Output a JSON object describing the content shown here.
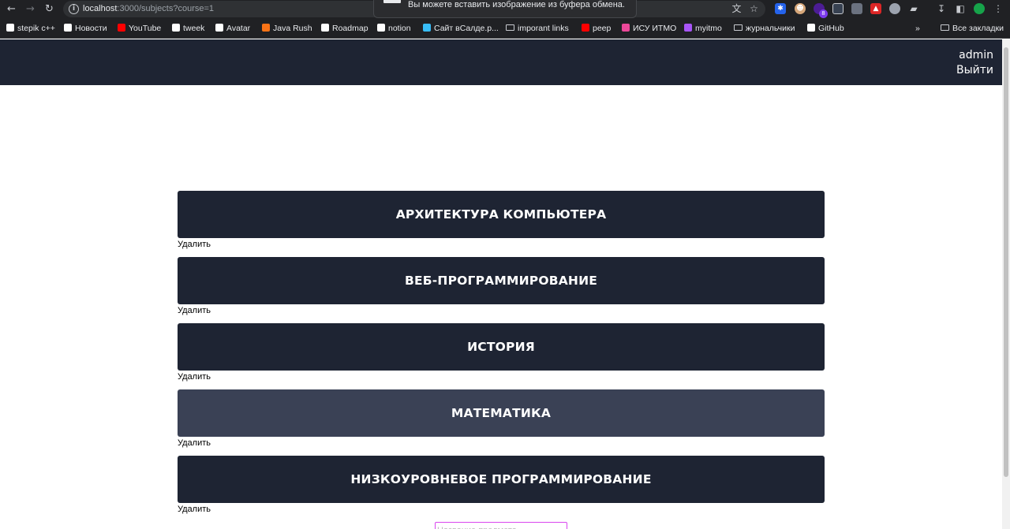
{
  "browser": {
    "url_host": "localhost",
    "url_rest": ":3000/subjects?course=1",
    "clipboard_popup": "Вы можете вставить изображение из буфера обмена.",
    "extension_badge": "8",
    "bookmarks": [
      {
        "label": "stepik c++",
        "icon": "stepik-icon",
        "color": "#ffffff"
      },
      {
        "label": "Новости",
        "icon": "vk-icon",
        "color": "#ffffff"
      },
      {
        "label": "YouTube",
        "icon": "youtube-icon",
        "color": "#ff0000"
      },
      {
        "label": "tweek",
        "icon": "tweek-icon",
        "color": "#ffffff"
      },
      {
        "label": "Avatar",
        "icon": "globe-icon",
        "color": "#ffffff"
      },
      {
        "label": "Java Rush",
        "icon": "javarush-icon",
        "color": "#f97316"
      },
      {
        "label": "Roadmap",
        "icon": "roadmap-icon",
        "color": "#ffffff"
      },
      {
        "label": "notion",
        "icon": "notion-icon",
        "color": "#ffffff"
      },
      {
        "label": "Сайт вСалде.р...",
        "icon": "site-icon",
        "color": "#38bdf8"
      },
      {
        "label": "imporant links",
        "icon": "folder-icon",
        "color": ""
      },
      {
        "label": "peep",
        "icon": "youtube-icon",
        "color": "#ff0000"
      },
      {
        "label": "ИСУ ИТМО",
        "icon": "itmo-icon",
        "color": "#ec4899"
      },
      {
        "label": "myitmo",
        "icon": "myitmo-icon",
        "color": "#a855f7"
      },
      {
        "label": "журнальчики",
        "icon": "folder-icon",
        "color": ""
      },
      {
        "label": "GitHub",
        "icon": "github-icon",
        "color": "#ffffff"
      }
    ],
    "more_bookmarks": "»",
    "all_bookmarks": "Все закладки"
  },
  "header": {
    "user": "admin",
    "logout": "Выйти"
  },
  "subjects": [
    {
      "title": "АРХИТЕКТУРА КОМПЬЮТЕРА",
      "delete": "Удалить"
    },
    {
      "title": "ВЕБ-ПРОГРАММИРОВАНИЕ",
      "delete": "Удалить"
    },
    {
      "title": "ИСТОРИЯ",
      "delete": "Удалить"
    },
    {
      "title": "МАТЕМАТИКА",
      "delete": "Удалить",
      "hovered": true
    },
    {
      "title": "НИЗКОУРОВНЕВОЕ ПРОГРАММИРОВАНИЕ",
      "delete": "Удалить"
    }
  ],
  "new_subject": {
    "placeholder": "Название предмета",
    "value": ""
  },
  "colors": {
    "header_bg": "#1e2433",
    "card_bg": "#1e2433",
    "card_hover_bg": "#3a4155",
    "input_border": "#d946ef"
  }
}
